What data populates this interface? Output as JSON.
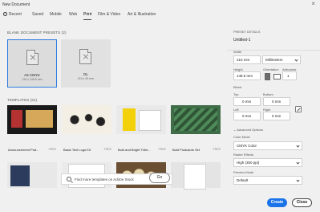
{
  "window": {
    "title": "New Document"
  },
  "tabs": [
    {
      "label": "Recent"
    },
    {
      "label": "Saved"
    },
    {
      "label": "Mobile"
    },
    {
      "label": "Web"
    },
    {
      "label": "Print"
    },
    {
      "label": "Film & Video"
    },
    {
      "label": "Art & Illustration"
    }
  ],
  "blank_presets": {
    "heading": "BLANK DOCUMENT PRESETS",
    "count": "(2)",
    "items": [
      {
        "name": "A5 CMYK",
        "dims": "210 x 148.5 mm"
      },
      {
        "name": "DL",
        "dims": "210 x 99 mm"
      }
    ]
  },
  "templates": {
    "heading": "TEMPLATES",
    "count": "(31)",
    "items": [
      {
        "name": "Announcement Pod...",
        "badge": "FREE"
      },
      {
        "name": "Basic Text Logo Kit",
        "badge": "FREE"
      },
      {
        "name": "Bold and Bright Trifol...",
        "badge": "FREE"
      },
      {
        "name": "Bold Postcards Set",
        "badge": "FREE"
      }
    ]
  },
  "stock_search": {
    "placeholder": "Find more templates on Adobe Stock",
    "go_label": "Go"
  },
  "preset_details": {
    "heading": "PRESET DETAILS",
    "doc_name": "Untitled-1",
    "width_label": "Width",
    "width_value": "210 mm",
    "units": "Millimeters",
    "height_label": "Height",
    "height_value": "148.5 mm",
    "orientation_label": "Orientation",
    "artboards_label": "Artboards",
    "artboards_value": "1",
    "bleed_label": "Bleed",
    "top_label": "Top",
    "top_value": "0 mm",
    "bottom_label": "Bottom",
    "bottom_value": "0 mm",
    "left_label": "Left",
    "left_value": "0 mm",
    "right_label": "Right",
    "right_value": "0 mm",
    "advanced_label": "Advanced Options",
    "color_mode_label": "Color Mode",
    "color_mode_value": "CMYK Color",
    "raster_label": "Raster Effects",
    "raster_value": "High (300 ppi)",
    "preview_label": "Preview Mode",
    "preview_value": "Default"
  },
  "footer": {
    "create_label": "Create",
    "close_label": "Close"
  },
  "colors": {
    "accent": "#1b73e8",
    "selected_border": "#2d7be0"
  }
}
